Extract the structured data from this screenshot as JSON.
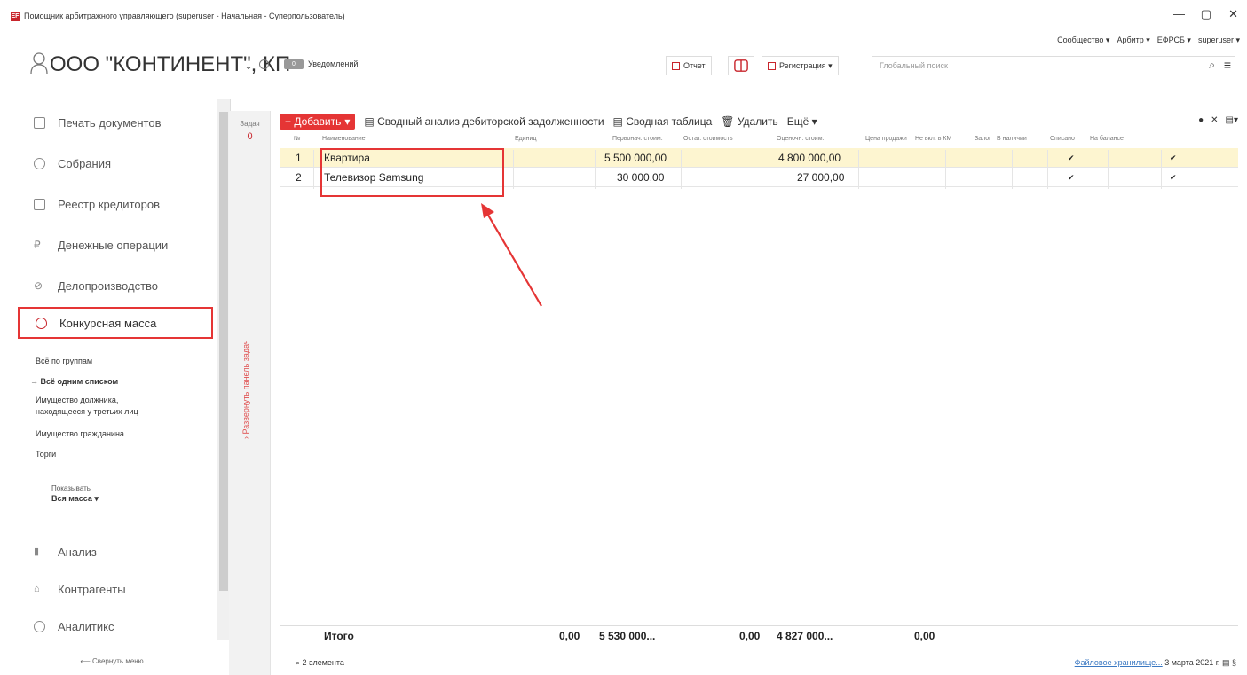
{
  "window": {
    "title": "Помощник арбитражного управляющего (superuser - Начальная - Суперпользователь)",
    "app_icon": "EF",
    "minimize": "—",
    "restore": "▢",
    "close": "✕"
  },
  "topnav": [
    "Сообщество ▾",
    "Арбитр ▾",
    "ЕФРСБ ▾",
    "superuser ▾"
  ],
  "header": {
    "company": "ООО \"КОНТИНЕНТ\", КП",
    "chevron": "⌄",
    "info": "i",
    "notif_count": "0",
    "notif_label": "Уведомлений",
    "report_btn": "Отчет",
    "registration_btn": "Регистрация ▾",
    "search_placeholder": "Глобальный поиск"
  },
  "sidebar": {
    "items": [
      {
        "label": "Печать документов"
      },
      {
        "label": "Собрания"
      },
      {
        "label": "Реестр кредиторов"
      },
      {
        "label": "Денежные операции"
      },
      {
        "label": "Делопроизводство"
      },
      {
        "label": "Конкурсная масса"
      },
      {
        "label": "Анализ"
      },
      {
        "label": "Контрагенты"
      },
      {
        "label": "Аналитикс"
      }
    ],
    "sub": [
      "Всё по группам",
      "→ Всё одним списком",
      "Имущество должника,",
      "находящееся у третьих лиц",
      "Имущество гражданина",
      "Торги"
    ],
    "show_label": "Показывать",
    "show_value": "Вся масса ▾",
    "collapse": "⟵ Свернуть меню"
  },
  "tasks": {
    "label": "Задач",
    "count": "0",
    "expand": "› Развернуть панель задач"
  },
  "toolbar": {
    "add": "+ Добавить",
    "add_caret": "▾",
    "summary_analysis": "▤ Сводный анализ дебиторской задолженности",
    "summary_table": "▤ Сводная таблица",
    "delete": "🗑 Удалить",
    "more": "Ещё ▾",
    "right": [
      "●",
      "✕",
      "▤▾"
    ]
  },
  "table": {
    "headers": [
      "№",
      "Наименование",
      "Единиц",
      "Первонач. стоим.",
      "Остат. стоимость",
      "Оценочн. стоим.",
      "Цена продажи",
      "Не вкл. в КМ",
      "Залог",
      "В наличии",
      "Списано",
      "На балансе"
    ],
    "rows": [
      {
        "n": "1",
        "name": "Квартира",
        "initial": "5 500 000,00",
        "estimated": "4 800 000,00",
        "in_stock": "✔",
        "on_balance": "✔"
      },
      {
        "n": "2",
        "name": "Телевизор Samsung",
        "initial": "30 000,00",
        "estimated": "27 000,00",
        "in_stock": "✔",
        "on_balance": "✔"
      }
    ],
    "total": {
      "label": "Итого",
      "units": "0,00",
      "initial": "5 530 000...",
      "residual": "0,00",
      "estimated": "4 827 000...",
      "sale": "0,00"
    }
  },
  "status": {
    "count": "⌕ 2 элемента",
    "storage": "Файловое хранилище...",
    "date": "3 марта 2021 г.",
    "icons": "▤  §"
  }
}
